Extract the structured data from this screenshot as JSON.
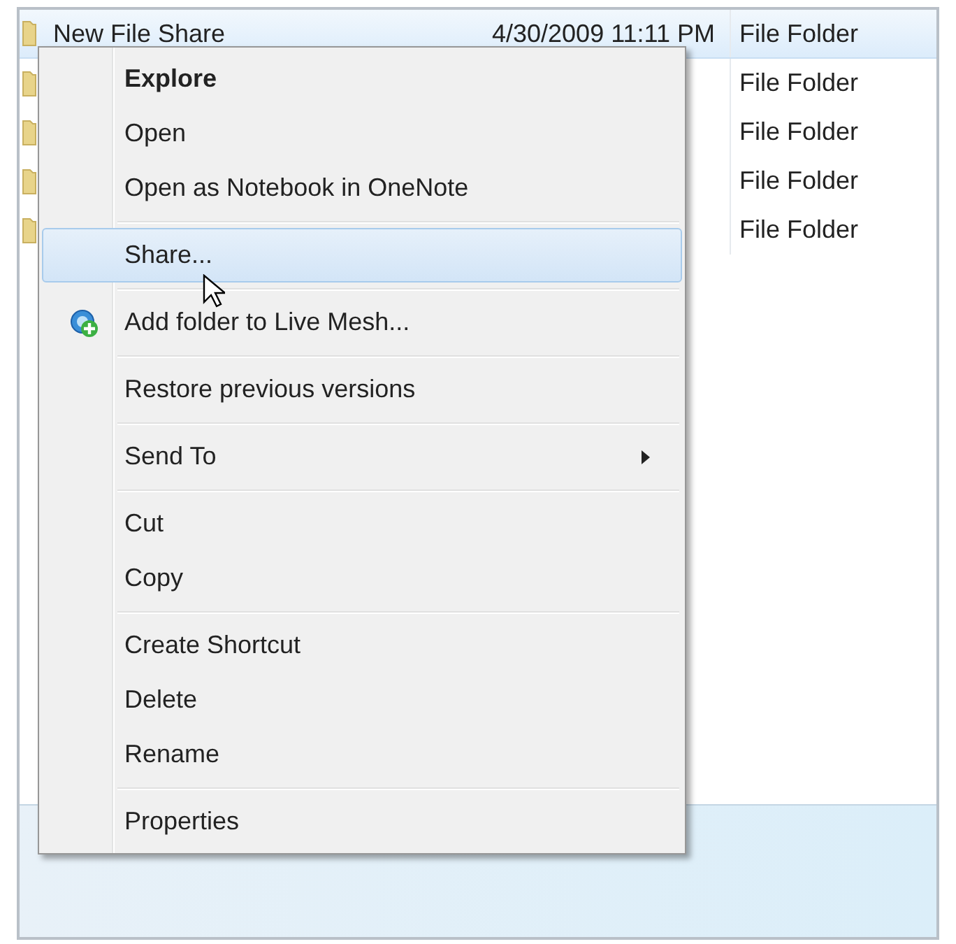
{
  "files": [
    {
      "name": "New File Share",
      "date": "4/30/2009 11:11 PM",
      "type": "File Folder",
      "selected": true
    },
    {
      "type": "File Folder",
      "selected": false
    },
    {
      "type": "File Folder",
      "selected": false
    },
    {
      "type": "File Folder",
      "selected": false
    },
    {
      "type": "File Folder",
      "selected": false
    }
  ],
  "context_menu": [
    {
      "kind": "item",
      "label": "Explore",
      "bold": true,
      "selected": false
    },
    {
      "kind": "item",
      "label": "Open",
      "bold": false,
      "selected": false
    },
    {
      "kind": "item",
      "label": "Open as Notebook in OneNote",
      "bold": false,
      "selected": false
    },
    {
      "kind": "separator"
    },
    {
      "kind": "item",
      "label": "Share...",
      "bold": false,
      "selected": true
    },
    {
      "kind": "separator"
    },
    {
      "kind": "icon_item",
      "label": "Add folder to Live Mesh...",
      "bold": false,
      "selected": false
    },
    {
      "kind": "separator"
    },
    {
      "kind": "item",
      "label": "Restore previous versions",
      "bold": false,
      "selected": false
    },
    {
      "kind": "separator"
    },
    {
      "kind": "submenu_item",
      "label": "Send To",
      "bold": false,
      "selected": false
    },
    {
      "kind": "separator"
    },
    {
      "kind": "item",
      "label": "Cut",
      "bold": false,
      "selected": false
    },
    {
      "kind": "item",
      "label": "Copy",
      "bold": false,
      "selected": false
    },
    {
      "kind": "separator"
    },
    {
      "kind": "item",
      "label": "Create Shortcut",
      "bold": false,
      "selected": false
    },
    {
      "kind": "item",
      "label": "Delete",
      "bold": false,
      "selected": false
    },
    {
      "kind": "item",
      "label": "Rename",
      "bold": false,
      "selected": false
    },
    {
      "kind": "separator"
    },
    {
      "kind": "item",
      "label": "Properties",
      "bold": false,
      "selected": false
    }
  ]
}
